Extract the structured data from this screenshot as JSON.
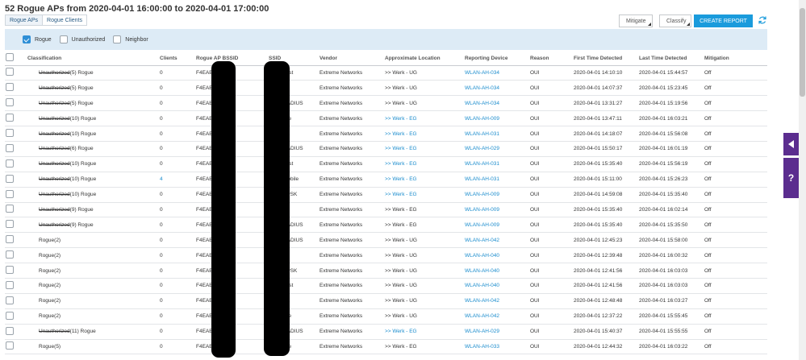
{
  "title": "52 Rogue APs from 2020-04-01 16:00:00 to 2020-04-01 17:00:00",
  "tabs": [
    "Rogue APs",
    "Rogue Clients"
  ],
  "toolbar": {
    "mitigate_label": "Mitigate",
    "classify_label": "Classify",
    "create_report_label": "CREATE REPORT",
    "accent_color": "#1a9bdc"
  },
  "filters": [
    {
      "label": "Rogue",
      "checked": true
    },
    {
      "label": "Unauthorized",
      "checked": false
    },
    {
      "label": "Neighbor",
      "checked": false
    }
  ],
  "columns": [
    "Classification",
    "Clients",
    "Rogue AP BSSID",
    "SSID",
    "Vendor",
    "Approximate Location",
    "Reporting Device",
    "Reason",
    "First Time Detected",
    "Last Time Detected",
    "Mitigation"
  ],
  "rows": [
    {
      "strike": "Unauthorized",
      "cls": "(5) Rogue",
      "clients": "0",
      "bssid": "F4EAB5",
      "ssid": "uest",
      "vendor": "Extreme Networks",
      "location": ">> Werk - UG",
      "loc_link": false,
      "device": "WLAN-AH-034",
      "reason": "OUI",
      "first": "2020-04-01 14:10:10",
      "last": "2020-04-01 15:44:57",
      "mitigation": "Off"
    },
    {
      "strike": "Unauthorized",
      "cls": "(5) Rogue",
      "clients": "0",
      "bssid": "F4EAB5",
      "ssid": "",
      "vendor": "Extreme Networks",
      "location": ">> Werk - UG",
      "loc_link": false,
      "device": "WLAN-AH-034",
      "reason": "OUI",
      "first": "2020-04-01 14:07:37",
      "last": "2020-04-01 15:23:45",
      "mitigation": "Off"
    },
    {
      "strike": "Unauthorized",
      "cls": "(5) Rogue",
      "clients": "0",
      "bssid": "F4EAB5",
      "ssid": "RADIUS",
      "vendor": "Extreme Networks",
      "location": ">> Werk - UG",
      "loc_link": false,
      "device": "WLAN-AH-034",
      "reason": "OUI",
      "first": "2020-04-01 13:31:27",
      "last": "2020-04-01 15:19:56",
      "mitigation": "Off"
    },
    {
      "strike": "Unauthorized",
      "cls": "(10) Rogue",
      "clients": "0",
      "bssid": "F4EAB5",
      "ssid": "tive",
      "vendor": "Extreme Networks",
      "location": ">> Werk - EG",
      "loc_link": true,
      "device": "WLAN-AH-009",
      "reason": "OUI",
      "first": "2020-04-01 13:47:11",
      "last": "2020-04-01 16:03:21",
      "mitigation": "Off"
    },
    {
      "strike": "Unauthorized",
      "cls": "(10) Rogue",
      "clients": "0",
      "bssid": "F4EAB5",
      "ssid": "PA",
      "vendor": "Extreme Networks",
      "location": ">> Werk - EG",
      "loc_link": true,
      "device": "WLAN-AH-031",
      "reason": "OUI",
      "first": "2020-04-01 14:18:07",
      "last": "2020-04-01 15:56:08",
      "mitigation": "Off"
    },
    {
      "strike": "Unauthorized",
      "cls": "(6) Rogue",
      "clients": "0",
      "bssid": "F4EAB5",
      "ssid": "RADIUS",
      "vendor": "Extreme Networks",
      "location": ">> Werk - EG",
      "loc_link": true,
      "device": "WLAN-AH-029",
      "reason": "OUI",
      "first": "2020-04-01 15:50:17",
      "last": "2020-04-01 16:01:19",
      "mitigation": "Off"
    },
    {
      "strike": "Unauthorized",
      "cls": "(10) Rogue",
      "clients": "0",
      "bssid": "F4EAB5",
      "ssid": "uest",
      "vendor": "Extreme Networks",
      "location": ">> Werk - EG",
      "loc_link": true,
      "device": "WLAN-AH-031",
      "reason": "OUI",
      "first": "2020-04-01 15:35:40",
      "last": "2020-04-01 15:56:19",
      "mitigation": "Off"
    },
    {
      "strike": "Unauthorized",
      "cls": "(10) Rogue",
      "clients": "4",
      "bssid": "F4EAB5",
      "ssid": "mobile",
      "vendor": "Extreme Networks",
      "location": ">> Werk - EG",
      "loc_link": true,
      "device": "WLAN-AH-031",
      "reason": "OUI",
      "first": "2020-04-01 15:11:00",
      "last": "2020-04-01 15:26:23",
      "mitigation": "Off"
    },
    {
      "strike": "Unauthorized",
      "cls": "(10) Rogue",
      "clients": "0",
      "bssid": "F4EAB5",
      "ssid": "PPSK",
      "vendor": "Extreme Networks",
      "location": ">> Werk - EG",
      "loc_link": true,
      "device": "WLAN-AH-009",
      "reason": "OUI",
      "first": "2020-04-01 14:59:08",
      "last": "2020-04-01 15:35:40",
      "mitigation": "Off"
    },
    {
      "strike": "Unauthorized",
      "cls": "(9) Rogue",
      "clients": "0",
      "bssid": "F4EAB5",
      "ssid": "",
      "vendor": "Extreme Networks",
      "location": ">> Werk - EG",
      "loc_link": false,
      "device": "WLAN-AH-009",
      "reason": "OUI",
      "first": "2020-04-01 15:35:40",
      "last": "2020-04-01 16:02:14",
      "mitigation": "Off"
    },
    {
      "strike": "Unauthorized",
      "cls": "(9) Rogue",
      "clients": "0",
      "bssid": "F4EAB5",
      "ssid": "RADIUS",
      "vendor": "Extreme Networks",
      "location": ">> Werk - EG",
      "loc_link": false,
      "device": "WLAN-AH-009",
      "reason": "OUI",
      "first": "2020-04-01 15:35:40",
      "last": "2020-04-01 15:35:50",
      "mitigation": "Off"
    },
    {
      "strike": "",
      "cls": "Rogue(2)",
      "clients": "0",
      "bssid": "F4EAB5",
      "ssid": "RADIUS",
      "vendor": "Extreme Networks",
      "location": ">> Werk - UG",
      "loc_link": false,
      "device": "WLAN-AH-042",
      "reason": "OUI",
      "first": "2020-04-01 12:45:23",
      "last": "2020-04-01 15:58:00",
      "mitigation": "Off"
    },
    {
      "strike": "",
      "cls": "Rogue(2)",
      "clients": "0",
      "bssid": "F4EAB5",
      "ssid": "",
      "vendor": "Extreme Networks",
      "location": ">> Werk - UG",
      "loc_link": false,
      "device": "WLAN-AH-040",
      "reason": "OUI",
      "first": "2020-04-01 12:39:48",
      "last": "2020-04-01 16:00:32",
      "mitigation": "Off"
    },
    {
      "strike": "",
      "cls": "Rogue(2)",
      "clients": "0",
      "bssid": "F4EAB5",
      "ssid": "PPSK",
      "vendor": "Extreme Networks",
      "location": ">> Werk - UG",
      "loc_link": false,
      "device": "WLAN-AH-040",
      "reason": "OUI",
      "first": "2020-04-01 12:41:56",
      "last": "2020-04-01 16:03:03",
      "mitigation": "Off"
    },
    {
      "strike": "",
      "cls": "Rogue(2)",
      "clients": "0",
      "bssid": "F4EAB5",
      "ssid": "uest",
      "vendor": "Extreme Networks",
      "location": ">> Werk - UG",
      "loc_link": false,
      "device": "WLAN-AH-040",
      "reason": "OUI",
      "first": "2020-04-01 12:41:56",
      "last": "2020-04-01 16:03:03",
      "mitigation": "Off"
    },
    {
      "strike": "",
      "cls": "Rogue(2)",
      "clients": "0",
      "bssid": "F4EAB5",
      "ssid": "PA",
      "vendor": "Extreme Networks",
      "location": ">> Werk - UG",
      "loc_link": false,
      "device": "WLAN-AH-042",
      "reason": "OUI",
      "first": "2020-04-01 12:48:48",
      "last": "2020-04-01 16:03:27",
      "mitigation": "Off"
    },
    {
      "strike": "",
      "cls": "Rogue(2)",
      "clients": "0",
      "bssid": "F4EAB5",
      "ssid": "tive",
      "vendor": "Extreme Networks",
      "location": ">> Werk - UG",
      "loc_link": false,
      "device": "WLAN-AH-042",
      "reason": "OUI",
      "first": "2020-04-01 12:37:22",
      "last": "2020-04-01 15:55:45",
      "mitigation": "Off"
    },
    {
      "strike": "Unauthorized",
      "cls": "(11) Rogue",
      "clients": "0",
      "bssid": "F4EAB5",
      "ssid": "RADIUS",
      "vendor": "Extreme Networks",
      "location": ">> Werk - EG",
      "loc_link": true,
      "device": "WLAN-AH-029",
      "reason": "OUI",
      "first": "2020-04-01 15:40:37",
      "last": "2020-04-01 15:55:55",
      "mitigation": "Off"
    },
    {
      "strike": "",
      "cls": "Rogue(5)",
      "clients": "0",
      "bssid": "F4EAB5",
      "ssid": "tive",
      "vendor": "Extreme Networks",
      "location": ">> Werk - EG",
      "loc_link": false,
      "device": "WLAN-AH-033",
      "reason": "OUI",
      "first": "2020-04-01 12:44:32",
      "last": "2020-04-01 16:03:22",
      "mitigation": "Off"
    }
  ]
}
